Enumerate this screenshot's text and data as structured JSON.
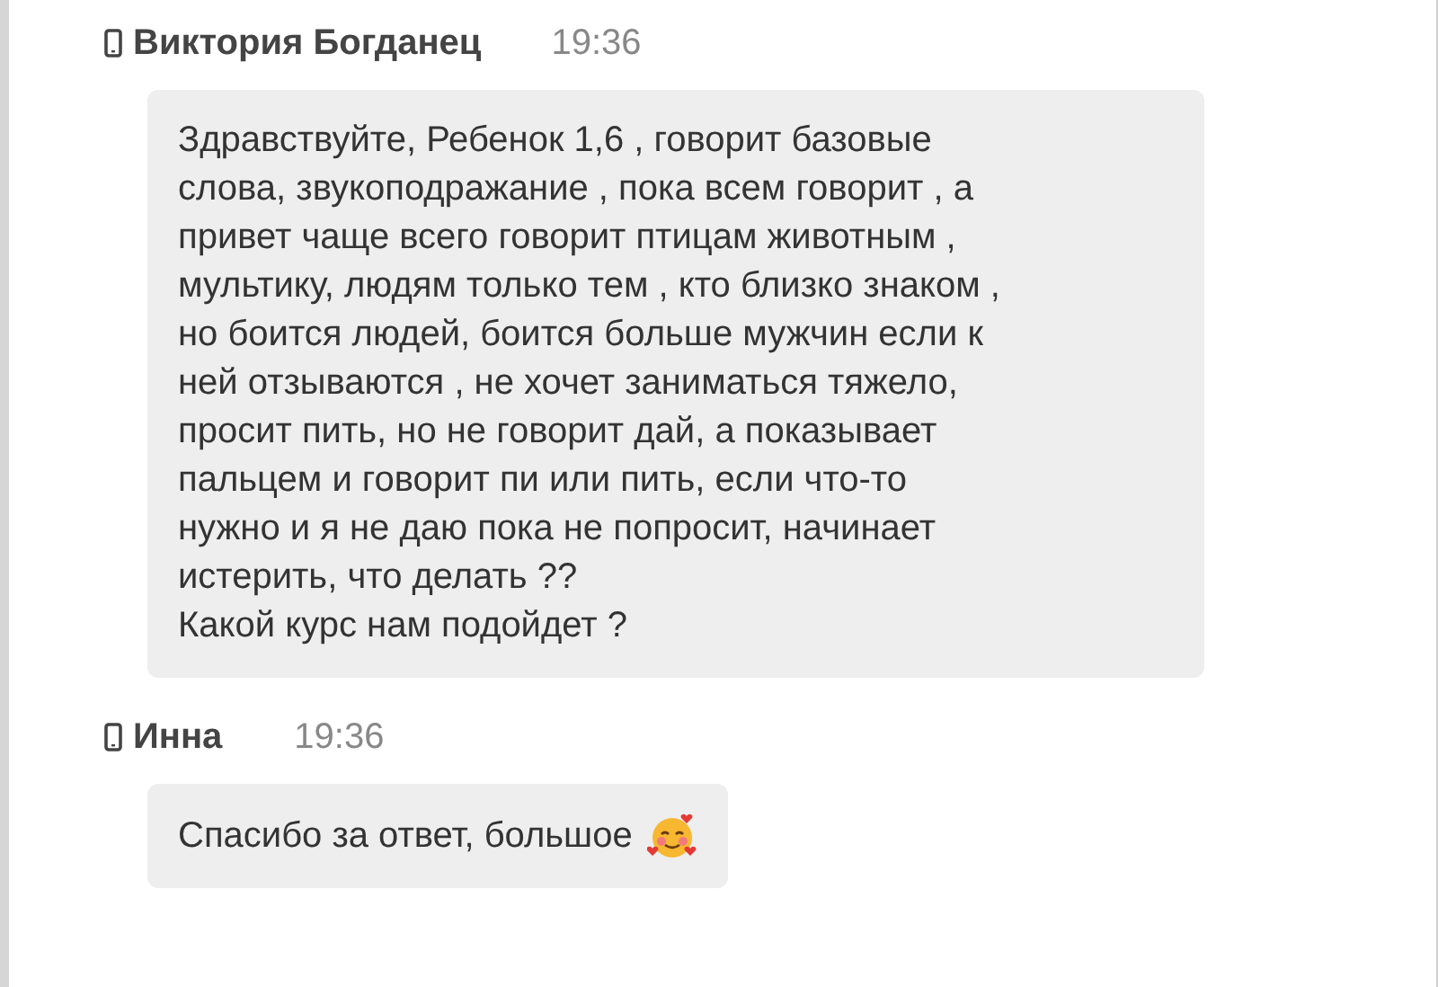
{
  "messages": [
    {
      "author": "Виктория Богданец",
      "time": "19:36",
      "text": "Здравствуйте, Ребенок 1,6 , говорит базовые\nслова, звукоподражание , пока всем говорит , а\nпривет чаще всего говорит птицам животным ,\nмультику, людям только тем , кто близко знаком ,\nно боится людей, боится больше мужчин если к\nней отзываются , не хочет заниматься тяжело,\nпросит пить, но не говорит дай, а показывает\nпальцем и говорит пи или пить, если что-то\nнужно и я не даю пока не попросит, начинает\nистерить, что делать ??\nКакой курс нам подойдет ?",
      "emoji": false
    },
    {
      "author": "Инна",
      "time": "19:36",
      "text": "Спасибо за ответ, большое",
      "emoji": true
    }
  ]
}
